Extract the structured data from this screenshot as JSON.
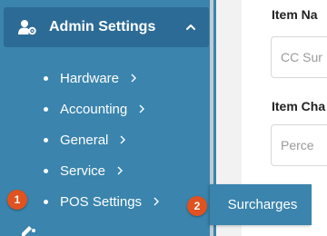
{
  "sidebar": {
    "header": {
      "icon": "user-gear-icon",
      "title": "Admin Settings",
      "chevron": "chevron-up-icon"
    },
    "items": [
      {
        "label": "Hardware"
      },
      {
        "label": "Accounting"
      },
      {
        "label": "General"
      },
      {
        "label": "Service"
      },
      {
        "label": "POS Settings"
      }
    ],
    "submenu": {
      "label": "Surcharges"
    }
  },
  "badges": {
    "first": "1",
    "second": "2"
  },
  "form": {
    "item_name_label": "Item Na",
    "item_name_placeholder": "CC Sur",
    "item_charge_label": "Item Cha",
    "item_charge_placeholder": "Perce"
  },
  "colors": {
    "sidebar": "#3a84ad",
    "header": "#2c6b95",
    "badge": "#e0521f"
  }
}
